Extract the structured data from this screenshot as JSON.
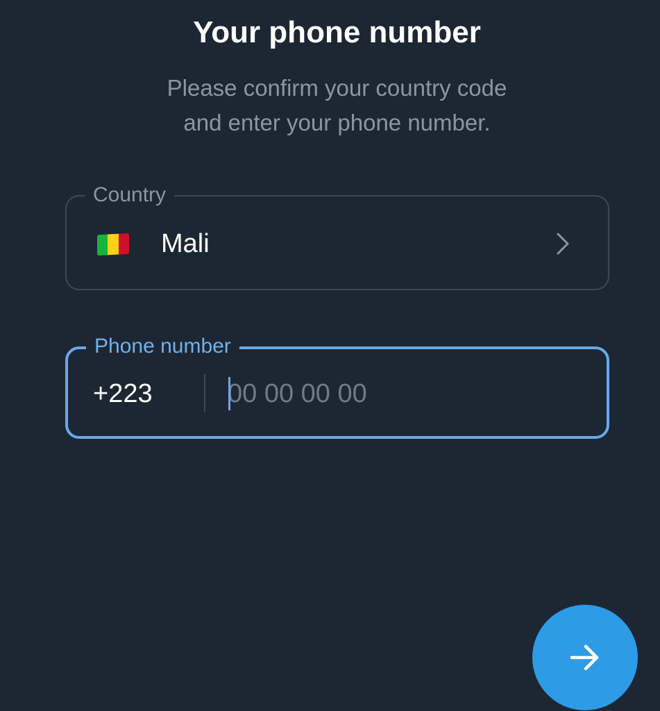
{
  "header": {
    "title": "Your phone number",
    "subtitle": "Please confirm your country code\nand enter your phone number."
  },
  "country": {
    "label": "Country",
    "name": "Mali",
    "flag_icon": "mali-flag-icon",
    "flag_colors": [
      "#14b53a",
      "#fcd116",
      "#ce1126"
    ],
    "chevron_icon": "chevron-right-icon"
  },
  "phone": {
    "label": "Phone number",
    "code": "+223",
    "value": "",
    "placeholder": "00 00 00 00"
  },
  "next_button": {
    "icon": "arrow-right-icon",
    "color": "#2d9be6"
  }
}
